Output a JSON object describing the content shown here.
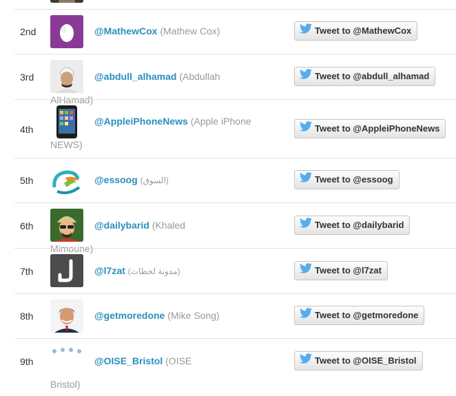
{
  "leaderboard": {
    "rows": [
      {
        "rank": "",
        "handle": "",
        "name": "",
        "button": ""
      },
      {
        "rank": "2nd",
        "handle": "@MathewCox",
        "name": "(Mathew Cox)",
        "button": "Tweet to @MathewCox"
      },
      {
        "rank": "3rd",
        "handle": "@abdull_alhamad",
        "name": "(Abdullah AlHamad)",
        "button": "Tweet to @abdull_alhamad"
      },
      {
        "rank": "4th",
        "handle": "@AppleiPhoneNews",
        "name": "(Apple iPhone NEWS)",
        "button": "Tweet to @AppleiPhoneNews"
      },
      {
        "rank": "5th",
        "handle": "@essoog",
        "name": "(السوق)",
        "button": "Tweet to @essoog"
      },
      {
        "rank": "6th",
        "handle": "@dailybarid",
        "name": "(Khaled Mimoune)",
        "button": "Tweet to @dailybarid"
      },
      {
        "rank": "7th",
        "handle": "@l7zat",
        "name": "(مدونة لحظات)",
        "button": "Tweet to @l7zat"
      },
      {
        "rank": "8th",
        "handle": "@getmoredone",
        "name": "(Mike Song)",
        "button": "Tweet to @getmoredone"
      },
      {
        "rank": "9th",
        "handle": "@OISE_Bristol",
        "name": "(OISE Bristol)",
        "button": "Tweet to @OISE_Bristol"
      }
    ]
  },
  "colors": {
    "handle": "#2a8fbd",
    "twitter_blue": "#55acee",
    "divider": "#e2e2e2"
  }
}
